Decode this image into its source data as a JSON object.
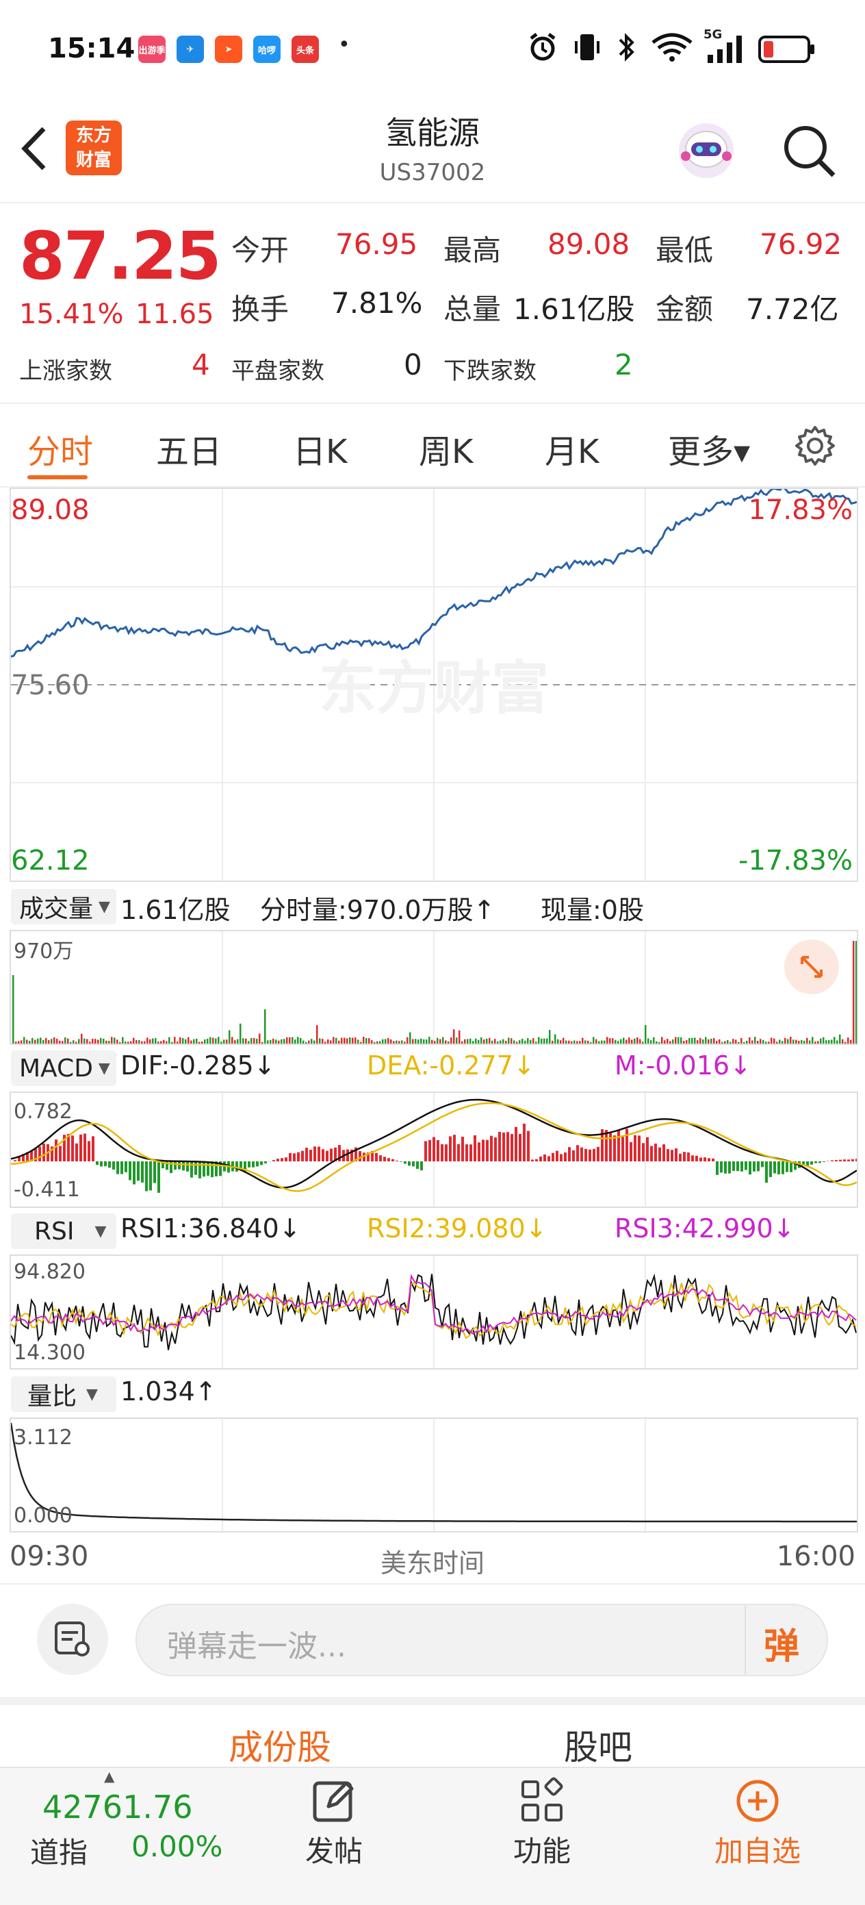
{
  "status_bar": {
    "time": "15:14",
    "apps": [
      {
        "icon": "chudaojia-app-icon",
        "label": "出游季",
        "color": "#f04a6a"
      },
      {
        "icon": "feishu-app-icon",
        "label": "✈",
        "color": "#1e88e5"
      },
      {
        "icon": "paper-plane-app-icon",
        "label": "➤",
        "color": "#ff5722"
      },
      {
        "icon": "hello-app-icon",
        "label": "哈啰",
        "color": "#2196f3"
      },
      {
        "icon": "toutiao-app-icon",
        "label": "头条",
        "color": "#e53935"
      }
    ],
    "dot": "•",
    "network": "5G"
  },
  "header": {
    "title": "氢能源",
    "code": "US37002",
    "logo_line1": "东方",
    "logo_line2": "财富"
  },
  "quote": {
    "price": "87.25",
    "change_pct": "15.41%",
    "change_amt": "11.65",
    "open_label": "今开",
    "open": "76.95",
    "high_label": "最高",
    "high": "89.08",
    "low_label": "最低",
    "low": "76.92",
    "turnover_label": "换手",
    "turnover": "7.81%",
    "volume_label": "总量",
    "volume": "1.61亿股",
    "amount_label": "金额",
    "amount": "7.72亿",
    "up_label": "上涨家数",
    "up": "4",
    "flat_label": "平盘家数",
    "flat": "0",
    "down_label": "下跌家数",
    "down": "2"
  },
  "tabs": {
    "items": [
      "分时",
      "五日",
      "日K",
      "周K",
      "月K",
      "更多▾"
    ],
    "active": "分时"
  },
  "main_chart": {
    "max_price": "89.08",
    "prev_close": "75.60",
    "min_price": "62.12",
    "max_pct": "17.83%",
    "min_pct": "-17.83%",
    "watermark": "东方财富"
  },
  "volume_panel": {
    "selector": "成交量",
    "total": "1.61亿股",
    "fen_shi": "分时量:970.0万股↑",
    "xian_liang": "现量:0股",
    "axis_max": "970万"
  },
  "macd_panel": {
    "selector": "MACD",
    "dif": "DIF:-0.285↓",
    "dea": "DEA:-0.277↓",
    "m": "M:-0.016↓",
    "axis_max": "0.782",
    "axis_min": "-0.411"
  },
  "rsi_panel": {
    "selector": "RSI",
    "rsi1": "RSI1:36.840↓",
    "rsi2": "RSI2:39.080↓",
    "rsi3": "RSI3:42.990↓",
    "axis_max": "94.820",
    "axis_min": "14.300"
  },
  "ratio_panel": {
    "selector": "量比",
    "value": "1.034↑",
    "axis_max": "3.112",
    "axis_min": "0.000"
  },
  "time_axis": {
    "start": "09:30",
    "label": "美东时间",
    "end": "16:00"
  },
  "comment": {
    "placeholder": "弹幕走一波...",
    "danmu_button": "弹"
  },
  "section_tabs": {
    "items": [
      "成份股",
      "股吧"
    ],
    "active": "成份股"
  },
  "bottom_nav": {
    "index_value": "42761.76",
    "index_name": "道指",
    "index_change": "0.00%",
    "post_label": "发帖",
    "func_label": "功能",
    "add_label": "加自选"
  },
  "colors": {
    "up": "#e0282e",
    "down": "#1e9a2a",
    "accent": "#f06a1e",
    "price_line": "#2a62a8",
    "dea_yellow": "#e8b800",
    "m_magenta": "#cc22cc"
  }
}
